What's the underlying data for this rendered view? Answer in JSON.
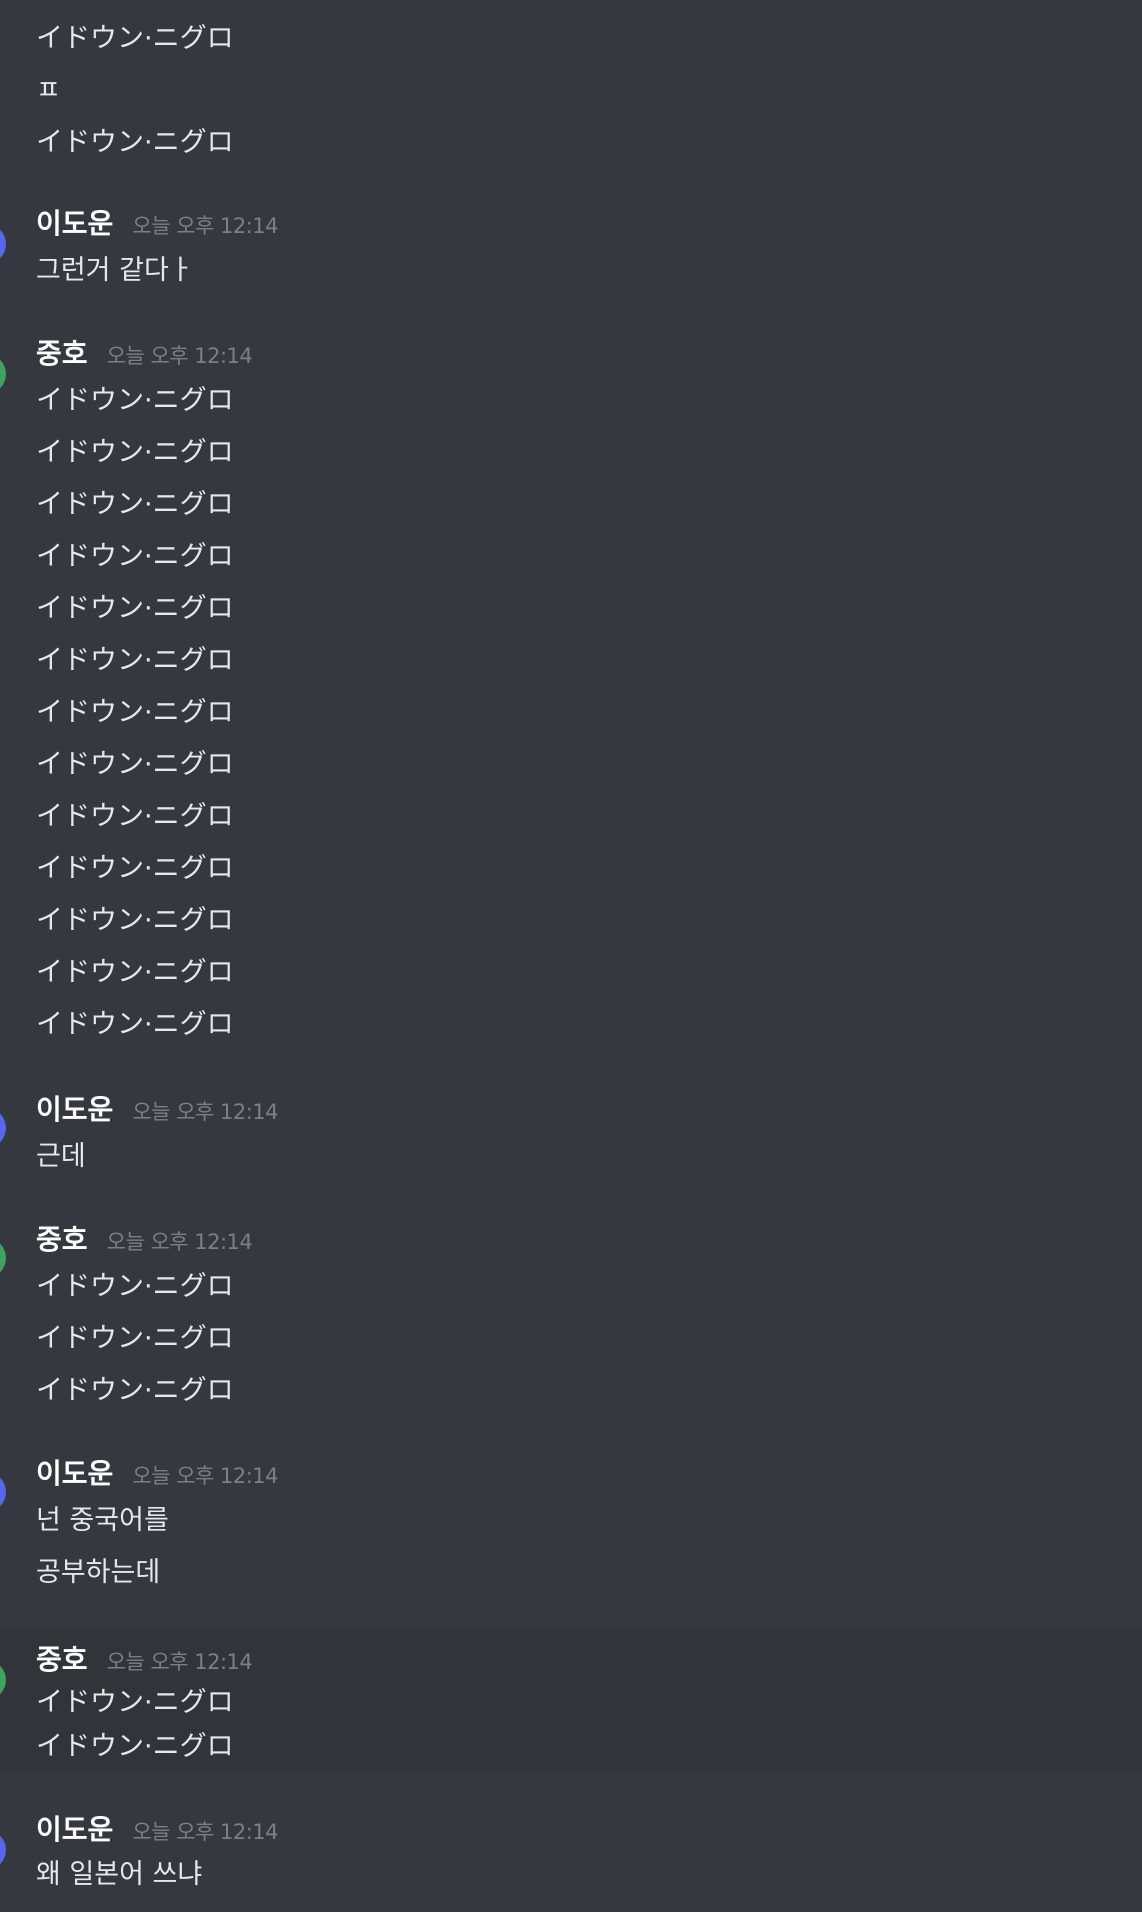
{
  "messages": {
    "m0_lines": [
      "イドウン·ニグロ",
      "ㅍ",
      "イドウン·ニグロ"
    ],
    "m1": {
      "user": "이도운",
      "time": "오늘 오후 12:14",
      "lines": [
        "그런거 같다ㅏ"
      ]
    },
    "m2": {
      "user": "중호",
      "time": "오늘 오후 12:14",
      "lines": [
        "イドウン·ニグロ",
        "イドウン·ニグロ",
        "イドウン·ニグロ",
        "イドウン·ニグロ",
        "イドウン·ニグロ",
        "イドウン·ニグロ",
        "イドウン·ニグロ",
        "イドウン·ニグロ",
        "イドウン·ニグロ",
        "イドウン·ニグロ",
        "イドウン·ニグロ",
        "イドウン·ニグロ",
        "イドウン·ニグロ"
      ]
    },
    "m3": {
      "user": "이도운",
      "time": "오늘 오후 12:14",
      "lines": [
        "근데"
      ]
    },
    "m4": {
      "user": "중호",
      "time": "오늘 오후 12:14",
      "lines": [
        "イドウン·ニグロ",
        "イドウン·ニグロ",
        "イドウン·ニグロ"
      ]
    },
    "m5": {
      "user": "이도운",
      "time": "오늘 오후 12:14",
      "lines": [
        "넌 중국어를",
        "공부하는데"
      ]
    },
    "m6": {
      "user": "중호",
      "time": "오늘 오후 12:14",
      "lines": [
        "イドウン·ニグロ",
        "イドウン·ニグロ"
      ]
    },
    "m7": {
      "user": "이도운",
      "time": "오늘 오후 12:14",
      "lines": [
        "왜 일본어 쓰냐"
      ]
    }
  },
  "colors": {
    "background": "#36383f",
    "hover_background": "#32343a",
    "avatar_doun": "#5865f2",
    "avatar_jungho": "#3ba55c",
    "timestamp": "#7c7f86"
  }
}
